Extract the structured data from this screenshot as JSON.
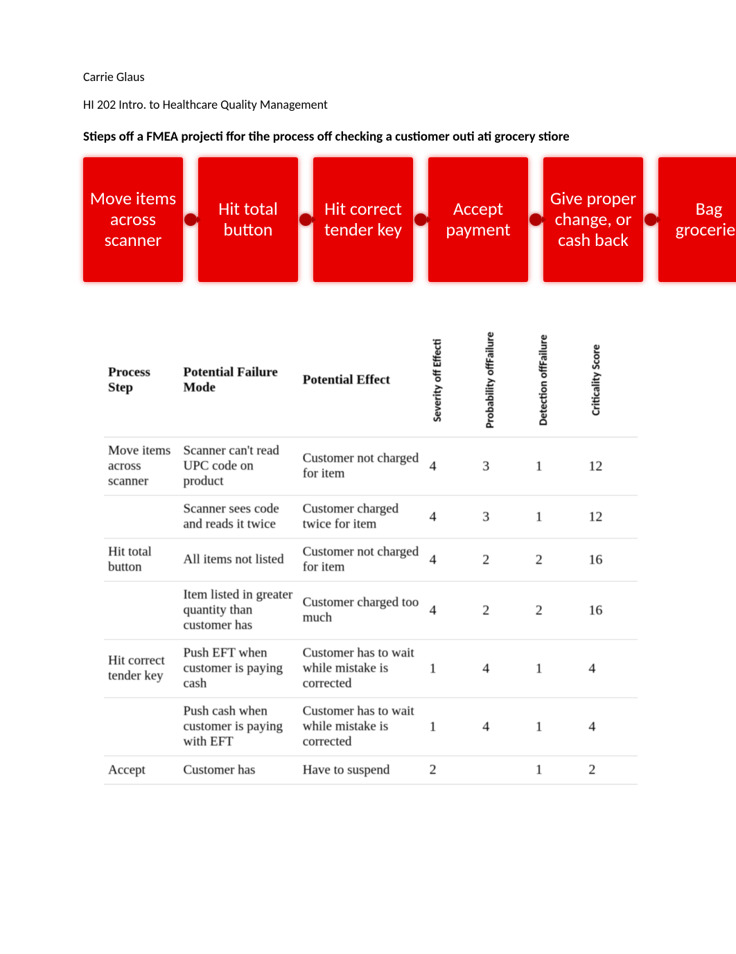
{
  "header": {
    "author": "Carrie Glaus",
    "course": "HI 202 Intro. to Healthcare Quality Management",
    "title": "Stieps off a FMEA projecti ffor tihe process off checking a custiomer outi ati grocery stiore"
  },
  "flow": {
    "steps": [
      "Move items across scanner",
      "Hit total button",
      "Hit correct tender key",
      "Accept payment",
      "Give proper change, or cash back",
      "Bag groceries"
    ]
  },
  "table": {
    "headers": {
      "process": "Process Step",
      "mode": "Potential Failure Mode",
      "effect": "Potential Effect",
      "severity": "Severity off Effecti",
      "probability": "Probability offFailure",
      "detection": "Detection offFailure",
      "criticality": "Criticality Score"
    },
    "rows": [
      {
        "process": "Move items across scanner",
        "mode": "Scanner can't read UPC code on product",
        "effect": "Customer not charged for item",
        "severity": "4",
        "probability": "3",
        "detection": "1",
        "criticality": "12"
      },
      {
        "process": "",
        "mode": "Scanner sees code and reads it twice",
        "effect": "Customer charged twice for item",
        "severity": "4",
        "probability": "3",
        "detection": "1",
        "criticality": "12"
      },
      {
        "process": "Hit total button",
        "mode": "All items not listed",
        "effect": "Customer not charged for item",
        "severity": "4",
        "probability": "2",
        "detection": "2",
        "criticality": "16"
      },
      {
        "process": "",
        "mode": "Item listed in greater quantity than customer has",
        "effect": "Customer charged too much",
        "severity": "4",
        "probability": "2",
        "detection": "2",
        "criticality": "16"
      },
      {
        "process": "Hit correct tender key",
        "mode": "Push EFT when customer is paying cash",
        "effect": "Customer has to wait while mistake is corrected",
        "severity": "1",
        "probability": "4",
        "detection": "1",
        "criticality": "4"
      },
      {
        "process": "",
        "mode": "Push cash when customer is paying with EFT",
        "effect": "Customer has to wait while mistake is corrected",
        "severity": "1",
        "probability": "4",
        "detection": "1",
        "criticality": "4"
      },
      {
        "process": "Accept",
        "mode": "Customer has",
        "effect": "Have to suspend",
        "severity": "2",
        "probability": "",
        "detection": "1",
        "criticality": "2"
      }
    ]
  }
}
